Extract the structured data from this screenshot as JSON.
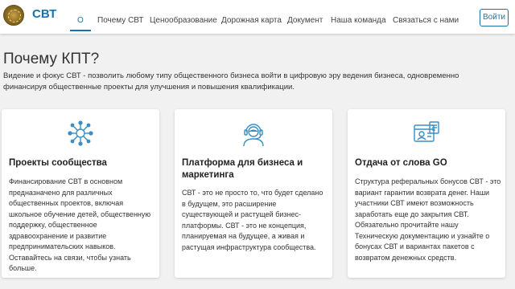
{
  "brand": "СВТ",
  "nav": {
    "items": [
      "О",
      "Почему СВТ",
      "Ценообразование",
      "Дорожная карта",
      "Документ",
      "Наша команда",
      "Связаться с нами"
    ],
    "active_index": 0
  },
  "login_label": "Войти",
  "section": {
    "title": "Почему КПТ?",
    "intro": "Видение и фокус СВТ - позволить любому типу общественного бизнеса войти в цифровую эру ведения бизнеса, одновременно финансируя общественные проекты для улучшения и повышения квалификации."
  },
  "cards": [
    {
      "icon": "network-icon",
      "title": "Проекты сообщества",
      "text": "Финансирование СВТ в основном предназначено для различных общественных проектов, включая школьное обучение детей, общественную поддержку, общественное здравоохранение и развитие предпринимательских навыков. Оставайтесь на связи, чтобы узнать больше."
    },
    {
      "icon": "support-agent-icon",
      "title": "Платформа для бизнеса и маркетинга",
      "text": "СВТ - это не просто то, что будет сделано в будущем, это расширение существующей и растущей бизнес-платформы. СВТ - это не концепция, планируемая на будущее, а живая и растущая инфраструктура сообщества."
    },
    {
      "icon": "id-card-icon",
      "title": "Отдача от слова GO",
      "text": "Структура реферальных бонусов СВТ - это вариант гарантии возврата денег. Наши участники СВТ имеют возможность заработать еще до закрытия СВТ. Обязательно прочитайте нашу Техническую документацию и узнайте о бонусах СВТ и вариантах пакетов с возвратом денежных средств."
    }
  ],
  "colors": {
    "accent": "#1a73a8",
    "icon": "#3a8fc2",
    "background": "#f1f1f1"
  }
}
